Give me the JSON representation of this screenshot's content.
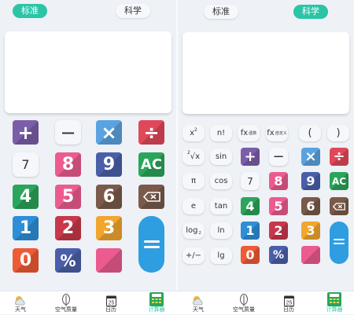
{
  "left": {
    "tabs": [
      "标准",
      "科学"
    ],
    "keys": {
      "plus": "+",
      "minus": "−",
      "multiply": "×",
      "divide": "÷",
      "seven": "7",
      "eight": "8",
      "nine": "9",
      "ac": "AC",
      "four": "4",
      "five": "5",
      "six": "6",
      "one": "1",
      "two": "2",
      "three": "3",
      "equals": "=",
      "zero": "0",
      "percent": "%"
    }
  },
  "right": {
    "tabs": [
      "标准",
      "科学"
    ],
    "sci": {
      "x2": "x",
      "x2_sup": "2",
      "fact": "n!",
      "fx1": "fx",
      "fx1_sub": "函数",
      "fx2": "fx",
      "fx2_sub": "自定义",
      "lparen": "(",
      "rparen": ")",
      "sqrt_idx": "2",
      "sqrt": "√x",
      "sin": "sin",
      "pi": "π",
      "cos": "cos",
      "e": "e",
      "tan": "tan",
      "log": "log",
      "log_sub": "2",
      "ln": "ln",
      "pm": "+/−",
      "lg": "lg"
    },
    "keys": {
      "plus": "+",
      "minus": "−",
      "multiply": "×",
      "divide": "÷",
      "seven": "7",
      "eight": "8",
      "nine": "9",
      "ac": "AC",
      "four": "4",
      "five": "5",
      "six": "6",
      "one": "1",
      "two": "2",
      "three": "3",
      "equals": "=",
      "zero": "0",
      "percent": "%"
    }
  },
  "nav": [
    "天气",
    "空气质量",
    "日历",
    "计算器"
  ],
  "nav_calendar_day": "25",
  "colors": {
    "accent": "#2bc4a7",
    "purple": "#7b5ea8",
    "blue": "#5aa3e0",
    "red": "#e0485a",
    "pink": "#ec5b8f",
    "navy": "#4a5fa8",
    "green": "#2aa55b",
    "brown": "#7a5a4a",
    "amber": "#f2a62e",
    "orange": "#ee5b35"
  }
}
